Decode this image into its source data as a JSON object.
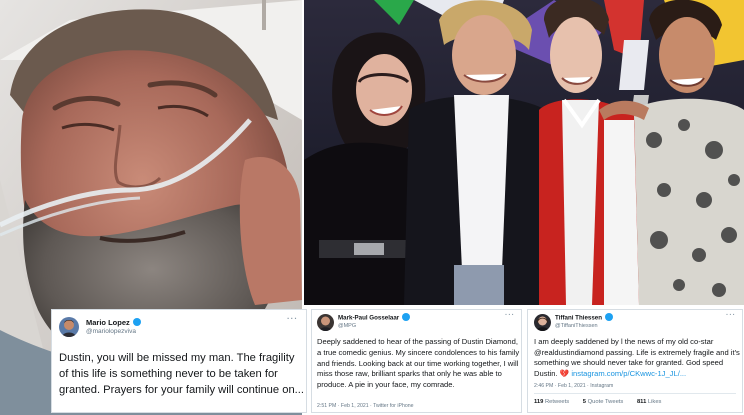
{
  "left_photo": {
    "description_name": "hospital-photo"
  },
  "right_photo": {
    "description_name": "cast-group-photo"
  },
  "tweets": [
    {
      "author": "Mario Lopez",
      "handle": "@mariolopezviva",
      "verified": true,
      "text": "Dustin, you will be missed my man. The fragility of this life is something never to be taken for granted.  Prayers for your family will continue on...",
      "menu": "···"
    },
    {
      "author": "Mark-Paul Gosselaar",
      "handle": "@MPG",
      "verified": true,
      "text": "Deeply saddened to hear of the passing of Dustin Diamond, a true comedic genius. My sincere condolences to his family and friends. Looking back at our time working together, I will miss those raw, brilliant sparks that only he was able to produce. A pie in your face, my comrade.",
      "meta": "2:51 PM · Feb 1, 2021 · Twitter for iPhone",
      "menu": "···"
    },
    {
      "author": "Tiffani Thiessen",
      "handle": "@TiffaniThiessen",
      "verified": true,
      "text_main": "I am deeply saddened by l the news of my old co-star @realdustindiamond passing. Life is extremely fragile and it's something we should never take for granted. God speed Dustin.",
      "text_heart": "💔",
      "text_link": "instagram.com/p/CKwwc-1J_JL/...",
      "meta": "2:46 PM · Feb 1, 2021 · Instagram",
      "retweets_count": "119",
      "retweets_label": "Retweets",
      "quotes_count": "5",
      "quotes_label": "Quote Tweets",
      "likes_count": "811",
      "likes_label": "Likes",
      "menu": "···"
    }
  ],
  "colors": {
    "verified": "#1da1f2",
    "link": "#1b95e0",
    "muted": "#657786"
  }
}
